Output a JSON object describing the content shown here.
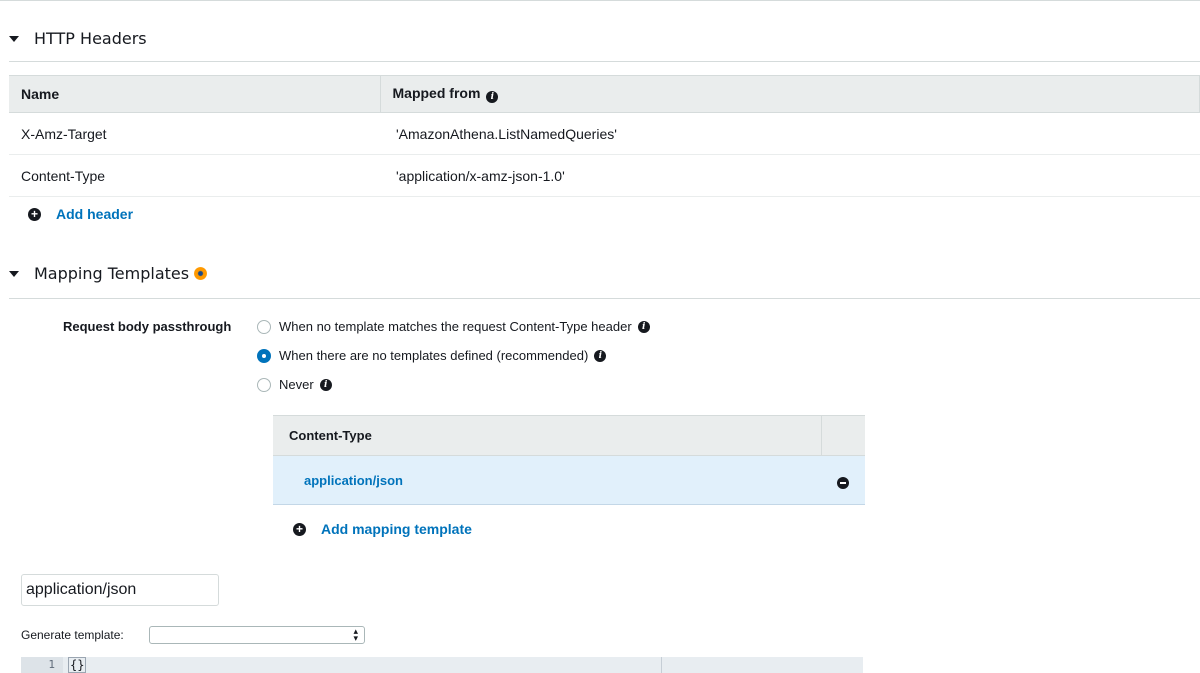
{
  "http_headers": {
    "title": "HTTP Headers",
    "columns": {
      "name": "Name",
      "mapped_from": "Mapped from"
    },
    "rows": [
      {
        "name": "X-Amz-Target",
        "mapped_from": "'AmazonAthena.ListNamedQueries'"
      },
      {
        "name": "Content-Type",
        "mapped_from": "'application/x-amz-json-1.0'"
      }
    ],
    "add_label": "Add header"
  },
  "mapping_templates": {
    "title": "Mapping Templates",
    "passthrough_label": "Request body passthrough",
    "options": [
      {
        "label": "When no template matches the request Content-Type header",
        "selected": false
      },
      {
        "label": "When there are no templates defined (recommended)",
        "selected": true
      },
      {
        "label": "Never",
        "selected": false
      }
    ],
    "content_type_header": "Content-Type",
    "content_types": [
      "application/json"
    ],
    "add_label": "Add mapping template",
    "selected_content_type_value": "application/json",
    "generate_label": "Generate template:",
    "generate_selected": "",
    "editor": {
      "line_number": "1",
      "code": "{}"
    }
  },
  "icons": {
    "expand": "caret-down-icon",
    "info": "info-icon",
    "add": "plus-circle-icon",
    "remove": "minus-circle-icon",
    "status": "status-dot-icon"
  },
  "colors": {
    "link": "#0073bb",
    "selected_row": "#e1f0fb",
    "accent": "#ff9900"
  }
}
